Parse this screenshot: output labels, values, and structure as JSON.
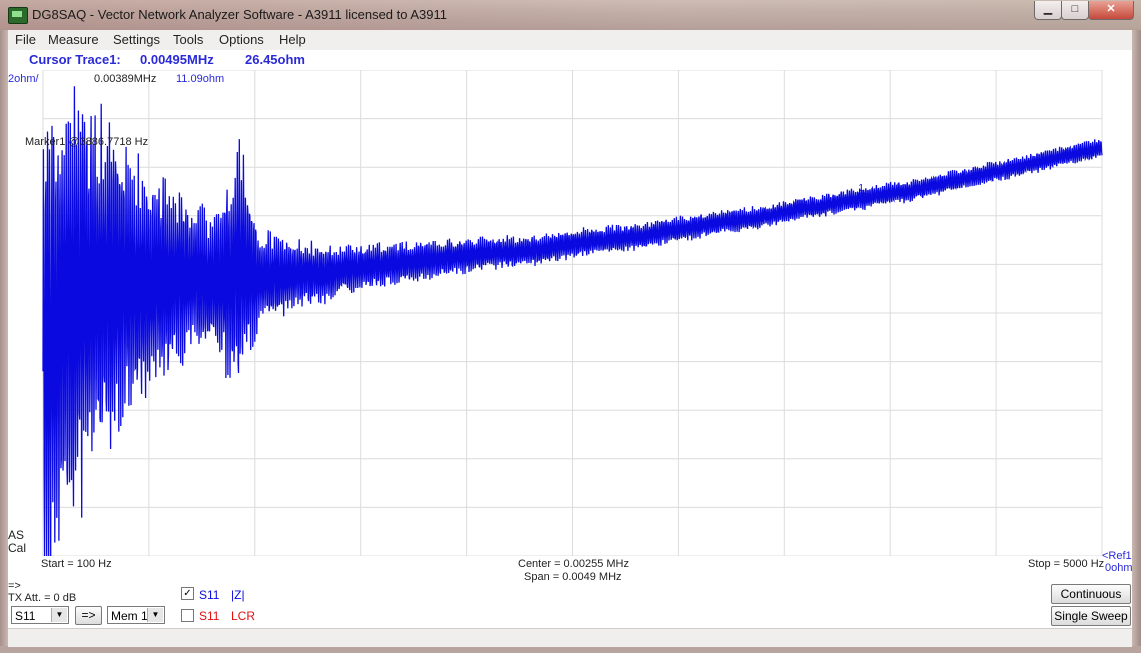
{
  "window": {
    "title": "DG8SAQ  -  Vector Network Analyzer Software  - A3911 licensed to A3911",
    "min_glyph": "▁",
    "max_glyph": "□",
    "close_glyph": "✕"
  },
  "menu": [
    "File",
    "Measure",
    "Settings",
    "Tools",
    "Options",
    "Help"
  ],
  "cursor": {
    "label": "Cursor Trace1:",
    "freq": "0.00495MHz",
    "value": "26.45ohm"
  },
  "plot": {
    "scale": "2ohm/",
    "readout_freq": "0.00389MHz",
    "readout_value": "11.09ohm",
    "marker_text": "Marker1 @3886.7718 Hz",
    "marker_number": "1",
    "as_label": "AS",
    "cal_label": "Cal",
    "start": "Start = 100 Hz",
    "center": "Center = 0.00255 MHz",
    "span": "Span = 0.0049 MHz",
    "stop": "Stop = 5000 Hz",
    "ref_label": "<Ref1",
    "ref_value": "0ohm",
    "trace_color": "#0a0ae0",
    "grid_color": "#dcdcdc"
  },
  "chart_data": {
    "type": "line",
    "xlabel": "",
    "ylabel": "",
    "x_range_hz": [
      100,
      5000
    ],
    "y_range_ohm": [
      0,
      20
    ],
    "y_scale_per_div": 2,
    "grid": true,
    "series": [
      {
        "x": [
          100,
          200,
          300,
          400,
          500,
          600,
          700,
          800,
          900,
          1000,
          1100,
          1200,
          1300,
          1400,
          1500,
          1600,
          1700,
          1800,
          1900,
          2000,
          2100,
          2200,
          2300,
          2400,
          2500,
          2600,
          2700,
          2800,
          2900,
          3000,
          3100,
          3200,
          3300,
          3400,
          3500,
          3600,
          3700,
          3800,
          3900,
          4000,
          4100,
          4200,
          4300,
          4400,
          4500,
          4600,
          4700,
          4800,
          4900,
          5000
        ],
        "y_center": [
          7.6,
          10.5,
          10.7,
          11.0,
          11.2,
          11.3,
          11.4,
          11.5,
          11.2,
          12.0,
          11.4,
          11.5,
          11.6,
          11.6,
          11.8,
          11.9,
          12.0,
          12.1,
          12.2,
          12.3,
          12.4,
          12.5,
          12.5,
          12.6,
          12.8,
          12.9,
          13.0,
          13.1,
          13.2,
          13.4,
          13.5,
          13.7,
          13.8,
          13.9,
          14.1,
          14.3,
          14.4,
          14.6,
          14.7,
          14.9,
          15.0,
          15.2,
          15.4,
          15.6,
          15.8,
          16.0,
          16.2,
          16.4,
          16.6,
          16.8
        ],
        "y_amplitude": [
          12,
          10,
          9,
          7.5,
          6,
          5,
          4.2,
          3.4,
          3.2,
          5.8,
          2.2,
          1.8,
          1.5,
          1.3,
          1.1,
          1.0,
          0.95,
          0.9,
          0.85,
          0.8,
          0.75,
          0.72,
          0.7,
          0.68,
          0.66,
          0.64,
          0.62,
          0.6,
          0.58,
          0.56,
          0.55,
          0.54,
          0.53,
          0.52,
          0.51,
          0.5,
          0.5,
          0.5,
          0.49,
          0.49,
          0.48,
          0.48,
          0.48,
          0.47,
          0.47,
          0.46,
          0.46,
          0.46,
          0.45,
          0.45
        ]
      }
    ]
  },
  "bottom": {
    "arrow_label": "=>",
    "tx_att": "TX Att.  = 0 dB",
    "param_select": "S11",
    "copy_button": "=>",
    "mem_select": "Mem 1",
    "trace1_check": "✓",
    "trace1_param": "S11",
    "trace1_format": "|Z|",
    "trace1_color": "#0a0ae0",
    "trace2_param": "S11",
    "trace2_format": "LCR",
    "trace2_color": "#e01010",
    "continuous_button": "Continuous",
    "single_sweep_button": "Single Sweep"
  }
}
